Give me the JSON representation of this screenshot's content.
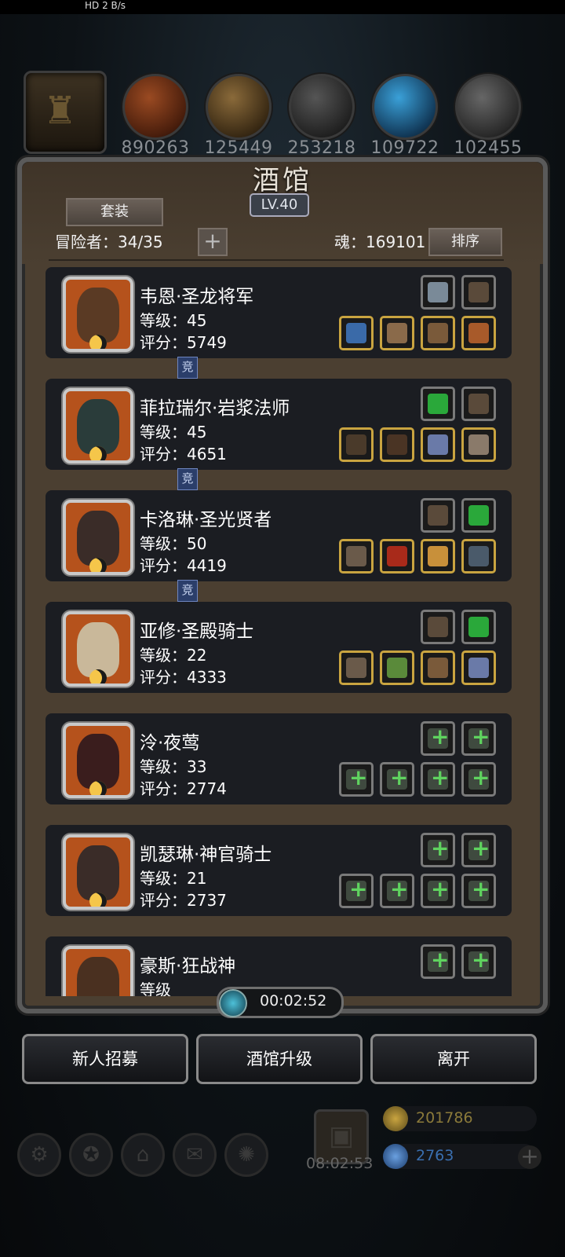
{
  "statusbar": {
    "left": "HD 2   B/s"
  },
  "resources": [
    {
      "icon": "meat-icon",
      "value": "890263"
    },
    {
      "icon": "wood-icon",
      "value": "125449"
    },
    {
      "icon": "stone-icon",
      "value": "253218"
    },
    {
      "icon": "crystal-icon",
      "value": "109722"
    },
    {
      "icon": "iron-icon",
      "value": "102455"
    }
  ],
  "tavern": {
    "title": "酒馆",
    "level": "LV.40"
  },
  "toolbar": {
    "suit_label": "套装",
    "adventurers_label": "冒险者：34/35",
    "add_label": "+",
    "soul_label": "魂：169101",
    "sort_label": "排序"
  },
  "heroes": [
    {
      "name": "韦恩·圣龙将军",
      "level": "等级：45",
      "score": "评分：5749",
      "badge": "竞",
      "face": "#5a3a24"
    },
    {
      "name": "菲拉瑞尔·岩浆法师",
      "level": "等级：45",
      "score": "评分：4651",
      "badge": "竞",
      "face": "#2a3c3a"
    },
    {
      "name": "卡洛琳·圣光贤者",
      "level": "等级：50",
      "score": "评分：4419",
      "badge": "竞",
      "face": "#3a2c28"
    },
    {
      "name": "亚修·圣殿骑士",
      "level": "等级：22",
      "score": "评分：4333",
      "badge": "",
      "face": "#c9b89a"
    },
    {
      "name": "泠·夜莺",
      "level": "等级：33",
      "score": "评分：2774",
      "badge": "",
      "face": "#3a1d1d"
    },
    {
      "name": "凯瑟琳·神官骑士",
      "level": "等级：21",
      "score": "评分：2737",
      "badge": "",
      "face": "#3a2c28"
    },
    {
      "name": "豪斯·狂战神",
      "level": "等级",
      "score": "",
      "badge": "",
      "face": "#4a3020"
    }
  ],
  "timer": {
    "value": "00:02:52"
  },
  "buttons": {
    "recruit": "新人招募",
    "upgrade": "酒馆升级",
    "leave": "离开"
  },
  "bottom": {
    "gift_time": "08:02:53",
    "gold": "201786",
    "gems": "2763"
  },
  "colors": {
    "gold_text": "#8b7a3a",
    "gem_text": "#3a6fb0",
    "slot_gold": "#c9a440"
  }
}
